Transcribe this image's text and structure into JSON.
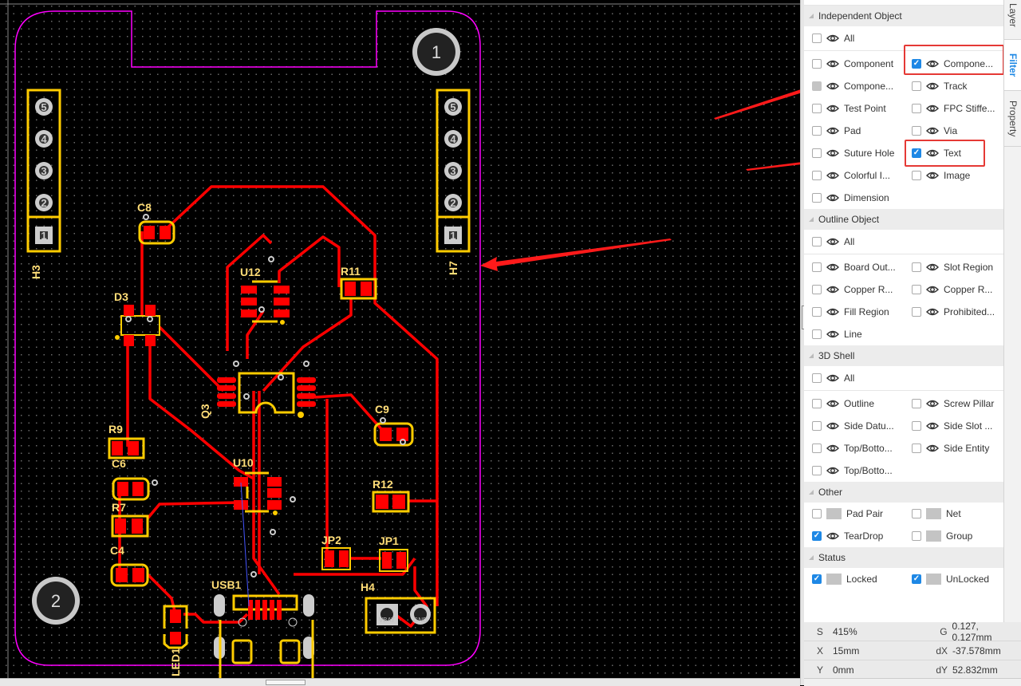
{
  "canvas": {
    "mounting_holes": [
      "1",
      "2"
    ],
    "designators": [
      "C8",
      "H3",
      "H7",
      "U12",
      "R11",
      "D3",
      "Q3",
      "C9",
      "R9",
      "C6",
      "U10",
      "R7",
      "R12",
      "C4",
      "JP2",
      "JP1",
      "USB1",
      "H4",
      "LED1"
    ],
    "header_pins": [
      "5",
      "4",
      "3",
      "2",
      "1"
    ],
    "h4_pins": [
      {
        "num": "1",
        "name": "VBAT"
      },
      {
        "num": "2",
        "name": "GND"
      }
    ],
    "colors": {
      "board_outline": "#ff00ff",
      "track": "#ff0000",
      "silkscreen": "#ffcc00",
      "pad": "#ff0000",
      "annotation_arrow": "#ff1a1a"
    }
  },
  "filter_panel": {
    "sections": [
      {
        "title": "Independent Object",
        "all": {
          "label": "All",
          "checked": false,
          "icon": "eye-icon"
        },
        "items": [
          {
            "label": "Component",
            "checked": false,
            "icon": "eye-icon"
          },
          {
            "label": "Compone...",
            "checked": true,
            "icon": "eye-icon",
            "highlighted": true
          },
          {
            "label": "Compone...",
            "checked": false,
            "disabled": true,
            "icon": "eye-icon"
          },
          {
            "label": "Track",
            "checked": false,
            "icon": "eye-icon"
          },
          {
            "label": "Test Point",
            "checked": false,
            "icon": "eye-icon"
          },
          {
            "label": "FPC Stiffe...",
            "checked": false,
            "icon": "eye-icon"
          },
          {
            "label": "Pad",
            "checked": false,
            "icon": "eye-icon"
          },
          {
            "label": "Via",
            "checked": false,
            "icon": "eye-icon"
          },
          {
            "label": "Suture Hole",
            "checked": false,
            "icon": "eye-icon"
          },
          {
            "label": "Text",
            "checked": true,
            "icon": "eye-icon",
            "highlighted": true
          },
          {
            "label": "Colorful I...",
            "checked": false,
            "icon": "eye-icon"
          },
          {
            "label": "Image",
            "checked": false,
            "icon": "eye-icon"
          },
          {
            "label": "Dimension",
            "checked": false,
            "icon": "eye-icon"
          }
        ]
      },
      {
        "title": "Outline Object",
        "all": {
          "label": "All",
          "checked": false,
          "icon": "eye-icon"
        },
        "items": [
          {
            "label": "Board Out...",
            "checked": false,
            "icon": "eye-icon"
          },
          {
            "label": "Slot Region",
            "checked": false,
            "icon": "eye-icon"
          },
          {
            "label": "Copper R...",
            "checked": false,
            "icon": "eye-icon"
          },
          {
            "label": "Copper R...",
            "checked": false,
            "icon": "eye-icon"
          },
          {
            "label": "Fill Region",
            "checked": false,
            "icon": "eye-icon"
          },
          {
            "label": "Prohibited...",
            "checked": false,
            "icon": "eye-icon"
          },
          {
            "label": "Line",
            "checked": false,
            "icon": "eye-icon"
          }
        ]
      },
      {
        "title": "3D Shell",
        "all": {
          "label": "All",
          "checked": false,
          "icon": "eye-icon"
        },
        "items": [
          {
            "label": "Outline",
            "checked": false,
            "icon": "eye-icon"
          },
          {
            "label": "Screw Pillar",
            "checked": false,
            "icon": "eye-icon"
          },
          {
            "label": "Side Datu...",
            "checked": false,
            "icon": "eye-icon"
          },
          {
            "label": "Side Slot ...",
            "checked": false,
            "icon": "eye-icon"
          },
          {
            "label": "Top/Botto...",
            "checked": false,
            "icon": "eye-icon"
          },
          {
            "label": "Side Entity",
            "checked": false,
            "icon": "eye-icon"
          },
          {
            "label": "Top/Botto...",
            "checked": false,
            "icon": "eye-icon"
          }
        ]
      },
      {
        "title": "Other",
        "items": [
          {
            "label": "Pad Pair",
            "checked": false,
            "icon": "swatch"
          },
          {
            "label": "Net",
            "checked": false,
            "icon": "swatch"
          },
          {
            "label": "TearDrop",
            "checked": true,
            "icon": "eye-icon"
          },
          {
            "label": "Group",
            "checked": false,
            "icon": "swatch"
          }
        ]
      },
      {
        "title": "Status",
        "items": [
          {
            "label": "Locked",
            "checked": true,
            "icon": "swatch"
          },
          {
            "label": "UnLocked",
            "checked": true,
            "icon": "swatch"
          }
        ]
      }
    ]
  },
  "side_tabs": [
    {
      "label": "Layer",
      "active": false
    },
    {
      "label": "Filter",
      "active": true
    },
    {
      "label": "Property",
      "active": false
    }
  ],
  "status_bar": {
    "scale": {
      "key": "S",
      "value": "415%"
    },
    "grid": {
      "key": "G",
      "value": "0.127, 0.127mm"
    },
    "x": {
      "key": "X",
      "value": "15mm"
    },
    "dx": {
      "key": "dX",
      "value": "-37.578mm"
    },
    "y": {
      "key": "Y",
      "value": "0mm"
    },
    "dy": {
      "key": "dY",
      "value": "52.832mm"
    }
  }
}
